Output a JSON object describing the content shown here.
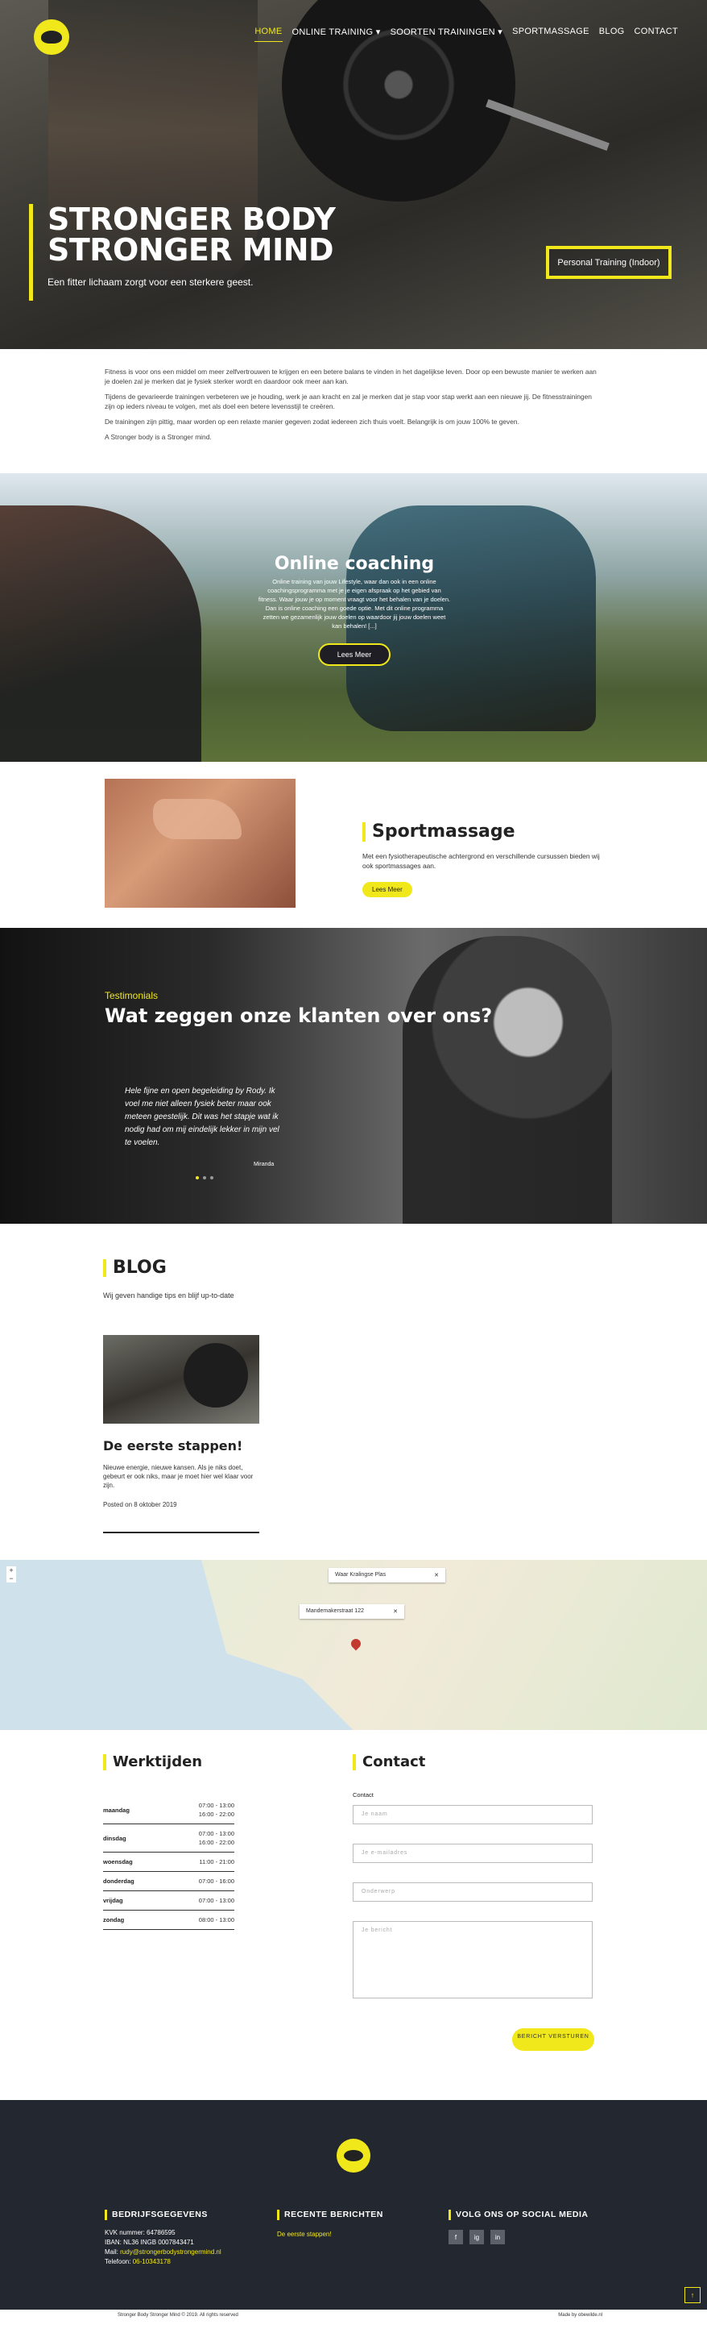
{
  "nav": {
    "items": [
      {
        "label": "HOME",
        "active": true
      },
      {
        "label": "ONLINE TRAINING"
      },
      {
        "label": "SOORTEN TRAININGEN"
      },
      {
        "label": "SPORTMASSAGE"
      },
      {
        "label": "BLOG"
      },
      {
        "label": "CONTACT"
      }
    ]
  },
  "hero": {
    "title_line1": "STRONGER BODY",
    "title_line2": "STRONGER MIND",
    "subtitle": "Een fitter lichaam zorgt voor een sterkere geest.",
    "button": "Personal Training (Indoor)"
  },
  "intro": [
    "Fitness is voor ons een middel om meer zelfvertrouwen te krijgen en een betere balans te vinden in het dagelijkse leven. Door op een bewuste manier te werken aan je doelen zal je merken dat je fysiek sterker wordt en daardoor ook meer aan kan.",
    "Tijdens de gevarieerde trainingen verbeteren we je houding, werk je aan kracht en zal je merken dat je stap voor stap werkt aan een nieuwe jij. De fitnesstrainingen zijn op ieders niveau te volgen, met als doel een betere levensstijl te creëren.",
    "De trainingen zijn pittig, maar worden op een relaxte manier gegeven zodat iedereen zich thuis voelt. Belangrijk is om jouw 100% te geven.",
    "A Stronger body is a Stronger mind."
  ],
  "online": {
    "title": "Online coaching",
    "text": "Online training van jouw Lifestyle, waar dan ook in een online coachingsprogramma met je je eigen afspraak op het gebied van fitness. Waar jouw je op moment vraagt voor het behalen van je doelen. Dan is online coaching een goede optie. Met dit online programma zetten we gezamenlijk jouw doelen op waardoor jij jouw doelen weet kan behalen! [...]",
    "button": "Lees Meer"
  },
  "massage": {
    "title": "Sportmassage",
    "text": "Met een fysiotherapeutische achtergrond en verschillende cursussen bieden wij ook sportmassages aan.",
    "button": "Lees Meer"
  },
  "testimonials": {
    "label": "Testimonials",
    "title": "Wat zeggen onze klanten over ons?",
    "quote": "Hele fijne en open begeleiding by Rody. Ik voel me niet alleen fysiek beter maar ook meteen geestelijk. Dit was het stapje wat ik nodig had om mij eindelijk lekker in mijn vel te voelen.",
    "author": "Miranda"
  },
  "blog": {
    "title": "BLOG",
    "intro": "Wij geven handige tips en blijf up-to-date",
    "post_title": "De eerste stappen!",
    "post_excerpt": "Nieuwe energie, nieuwe kansen. Als je niks doet, gebeurt er ook niks, maar je moet hier wel klaar voor zijn.",
    "post_date": "Posted on 8 oktober 2019"
  },
  "map": {
    "popup1_label": "Waar",
    "popup1_value": "Kralingse Plas",
    "popup2_value": "Mandemakerstraat 122"
  },
  "hours": {
    "title": "Werktijden",
    "rows": [
      {
        "day": "maandag",
        "time": "07:00 - 13:00\n16:00 - 22:00"
      },
      {
        "day": "dinsdag",
        "time": "07:00 - 13:00\n16:00 - 22:00"
      },
      {
        "day": "woensdag",
        "time": "11:00 - 21:00"
      },
      {
        "day": "donderdag",
        "time": "07:00 - 16:00"
      },
      {
        "day": "vrijdag",
        "time": "07:00 - 13:00"
      },
      {
        "day": "zondag",
        "time": "08:00 - 13:00"
      }
    ]
  },
  "contact": {
    "title": "Contact",
    "label": "Contact",
    "name_placeholder": "Je naam",
    "email_placeholder": "Je e-mailadres",
    "subject_placeholder": "Onderwerp",
    "message_placeholder": "Je bericht",
    "send": "BERICHT VERSTUREN"
  },
  "footer": {
    "company_title": "BEDRIJFSGEGEVENS",
    "kvk": "KVK nummer: 64786595",
    "iban": "IBAN: NL36 INGB 0007843471",
    "mail_label": "Mail:",
    "mail": "rudy@strongerbodystrongermind.nl",
    "phone_label": "Telefoon:",
    "phone": "06-10343178",
    "recent_title": "RECENTE BERICHTEN",
    "recent_post": "De eerste stappen!",
    "social_title": "VOLG ONS OP SOCIAL MEDIA",
    "social": [
      "f",
      "ig",
      "in"
    ],
    "copyright": "Stronger Body Stronger Mind © 2019. All rights reserved",
    "made_by": "Made by obewilde.nl"
  },
  "colors": {
    "accent": "#f1e81b",
    "footer": "#23272f"
  }
}
